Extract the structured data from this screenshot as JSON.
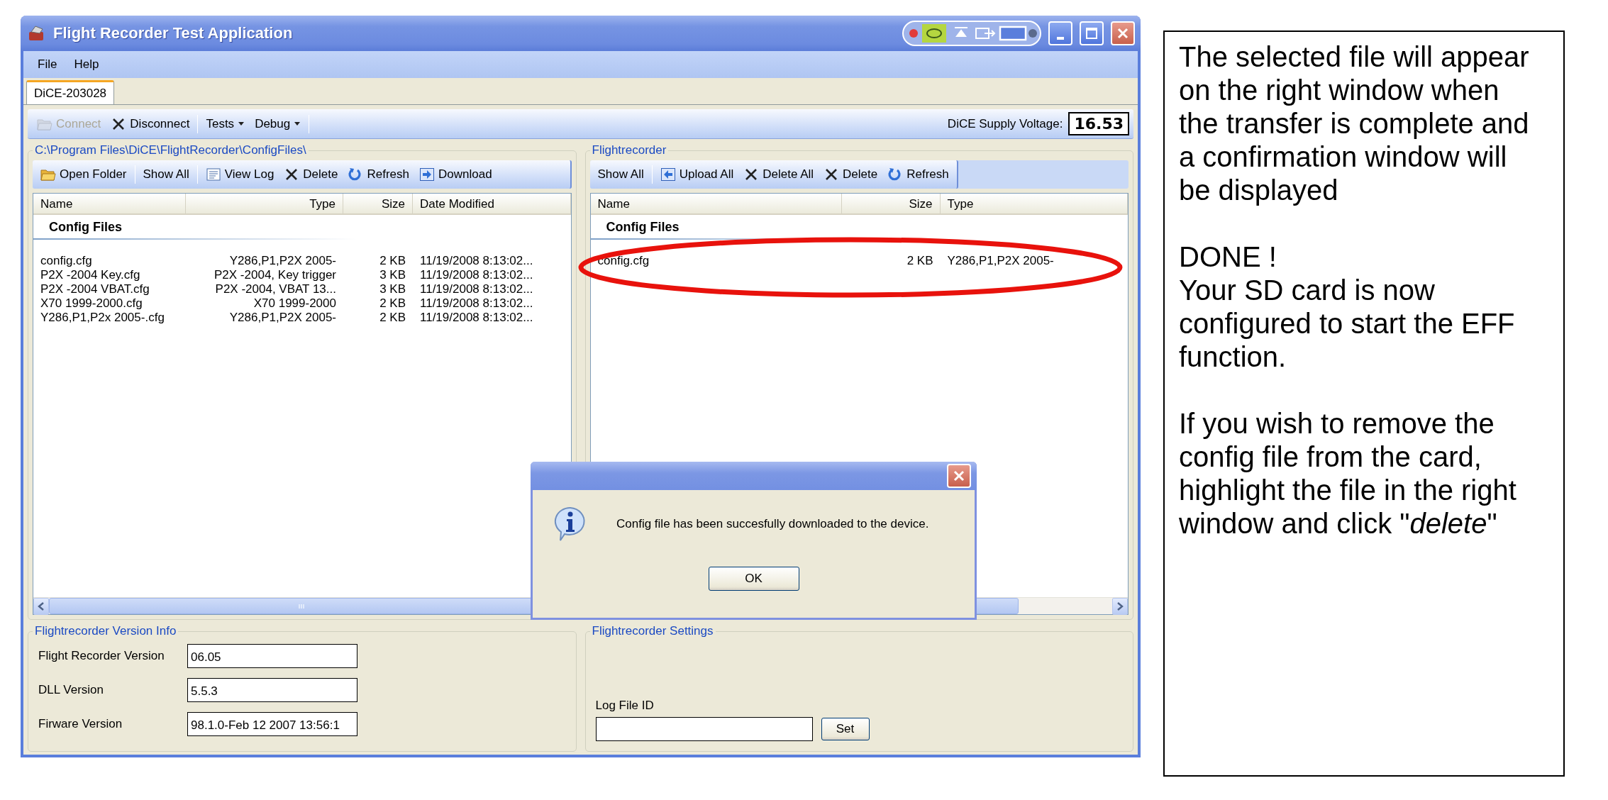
{
  "window": {
    "title": "Flight Recorder Test Application"
  },
  "menu": [
    "File",
    "Help"
  ],
  "tabs": [
    {
      "label": "DiCE-203028",
      "selected": true
    }
  ],
  "toolbar": [
    [
      {
        "label": "Connect",
        "kind": "folder",
        "disabled": true
      },
      {
        "label": "Disconnect",
        "kind": "cross",
        "disabled": false
      }
    ],
    [
      {
        "label": "Tests",
        "kind": "dropdown",
        "disabled": false
      },
      {
        "label": "Debug",
        "kind": "dropdown",
        "disabled": false
      }
    ]
  ],
  "voltage": {
    "label": "DiCE Supply Voltage:",
    "value": "16.53"
  },
  "local_panel": {
    "title": "C:\\Program Files\\DiCE\\FlightRecorder\\ConfigFiles\\",
    "toolbar": [
      [
        {
          "label": "Open Folder",
          "kind": "folder",
          "disabled": false
        }
      ],
      [
        {
          "label": "Show All",
          "kind": "text",
          "disabled": false
        }
      ],
      [
        {
          "label": "View Log",
          "kind": "log",
          "disabled": false
        },
        {
          "label": "Delete",
          "kind": "cross",
          "disabled": false
        },
        {
          "label": "Refresh",
          "kind": "refresh",
          "disabled": false
        },
        {
          "label": "Download",
          "kind": "download",
          "disabled": false
        }
      ]
    ],
    "columns": [
      "Name",
      "Type",
      "Size",
      "Date Modified"
    ],
    "group": "Config Files",
    "rows": [
      [
        "config.cfg",
        "Y286,P1,P2X 2005-",
        "2 KB",
        "11/19/2008 8:13:02..."
      ],
      [
        "P2X -2004 Key.cfg",
        "P2X -2004, Key trigger",
        "3 KB",
        "11/19/2008 8:13:02..."
      ],
      [
        "P2X -2004 VBAT.cfg",
        "P2X -2004, VBAT 13...",
        "3 KB",
        "11/19/2008 8:13:02..."
      ],
      [
        "X70 1999-2000.cfg",
        "X70 1999-2000",
        "2 KB",
        "11/19/2008 8:13:02..."
      ],
      [
        "Y286,P1,P2x 2005-.cfg",
        "Y286,P1,P2X 2005-",
        "2 KB",
        "11/19/2008 8:13:02..."
      ]
    ]
  },
  "device_panel": {
    "title": "Flightrecorder",
    "toolbar": [
      [
        {
          "label": "Show All",
          "kind": "text",
          "disabled": false
        }
      ],
      [
        {
          "label": "Upload All",
          "kind": "upload",
          "disabled": false
        },
        {
          "label": "Delete All",
          "kind": "cross",
          "disabled": false
        },
        {
          "label": "Delete",
          "kind": "cross",
          "disabled": false
        },
        {
          "label": "Refresh",
          "kind": "refresh",
          "disabled": false
        }
      ]
    ],
    "columns": [
      "Name",
      "Size",
      "Type"
    ],
    "group": "Config Files",
    "rows": [
      [
        "config.cfg",
        "2 KB",
        "Y286,P1,P2X 2005-"
      ]
    ]
  },
  "version_info": {
    "title": "Flightrecorder Version Info",
    "fields": [
      {
        "label": "Flight Recorder Version",
        "value": "06.05"
      },
      {
        "label": "DLL Version",
        "value": "5.5.3"
      },
      {
        "label": "Firware Version",
        "value": "98.1.0-Feb 12 2007 13:56:1"
      }
    ]
  },
  "settings": {
    "title": "Flightrecorder Settings",
    "field_label": "Log File ID",
    "button": "Set"
  },
  "dialog": {
    "message": "Config file has been succesfully downloaded to the device.",
    "button": "OK"
  },
  "annotation": {
    "paragraphs": [
      [
        "The selected file will appear on the right window when the transfer is complete and a confirmation window will be displayed"
      ],
      [
        "DONE !",
        "Your SD card is now configured to start the EFF function."
      ],
      [
        "If you wish to remove the config file from the card, highlight the file in the right window and click \"*delete*\""
      ]
    ]
  }
}
